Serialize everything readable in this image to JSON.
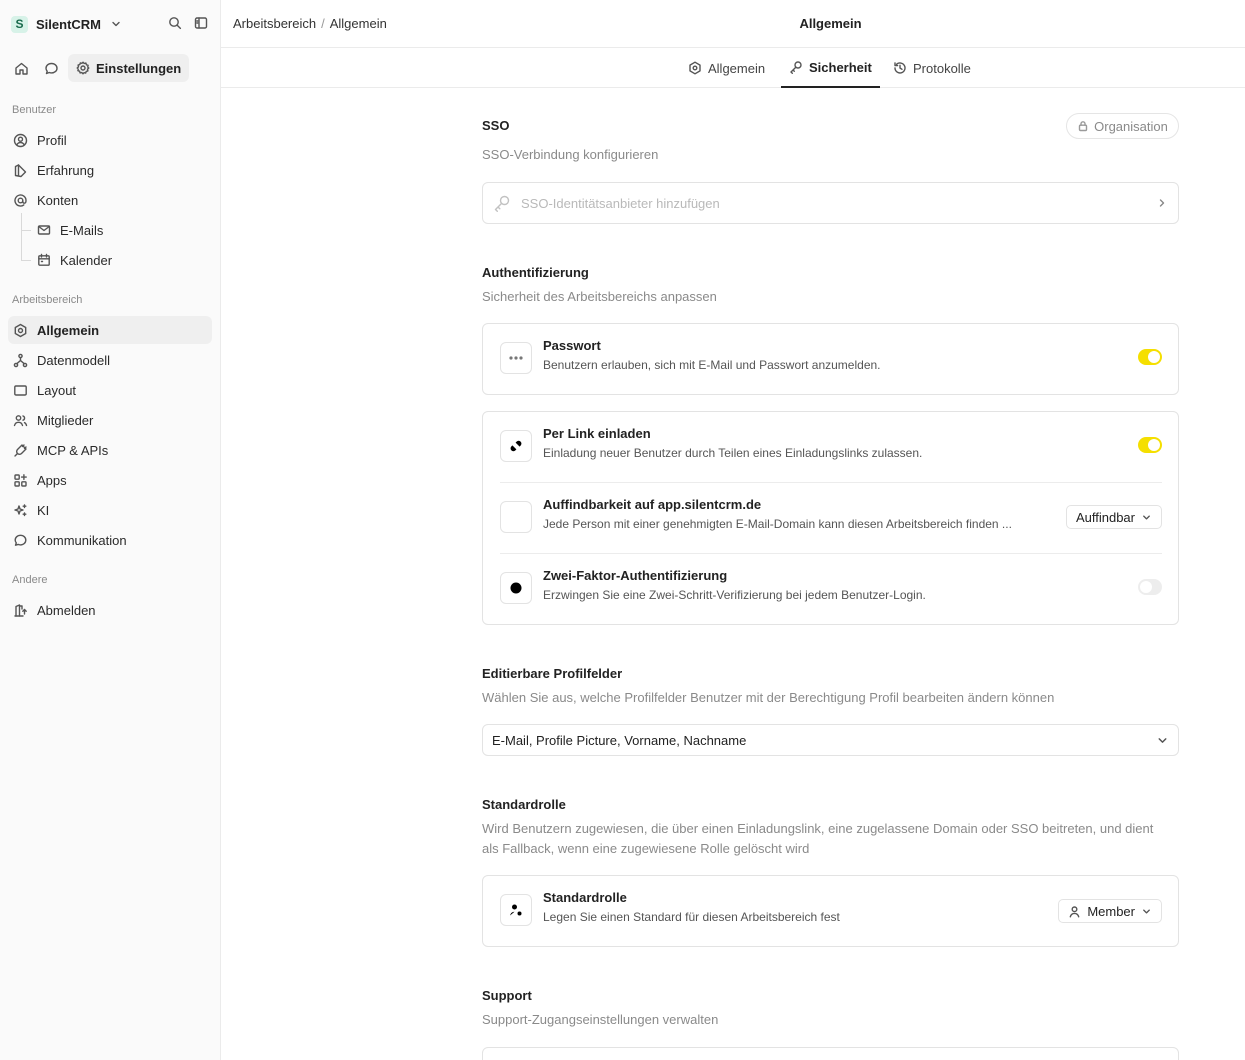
{
  "workspace": {
    "logo_letter": "S",
    "name": "SilentCRM"
  },
  "sidebar": {
    "top_nav": {
      "settings_label": "Einstellungen"
    },
    "sections": {
      "user": "Benutzer",
      "workspace": "Arbeitsbereich",
      "other": "Andere"
    },
    "user_items": [
      "Profil",
      "Erfahrung",
      "Konten",
      "E-Mails",
      "Kalender"
    ],
    "workspace_items": [
      "Allgemein",
      "Datenmodell",
      "Layout",
      "Mitglieder",
      "MCP & APIs",
      "Apps",
      "KI",
      "Kommunikation"
    ],
    "other_items": [
      "Abmelden"
    ]
  },
  "header": {
    "breadcrumb": [
      "Arbeitsbereich",
      "/",
      "Allgemein"
    ],
    "title": "Allgemein"
  },
  "tabs": [
    "Allgemein",
    "Sicherheit",
    "Protokolle"
  ],
  "active_tab": "Sicherheit",
  "sso": {
    "title": "SSO",
    "badge": "Organisation",
    "description": "SSO-Verbindung konfigurieren",
    "add_placeholder": "SSO-Identitätsanbieter hinzufügen"
  },
  "auth": {
    "title": "Authentifizierung",
    "description": "Sicherheit des Arbeitsbereichs anpassen",
    "password": {
      "title": "Passwort",
      "subtitle": "Benutzern erlauben, sich mit E-Mail und Passwort anzumelden.",
      "enabled": true
    },
    "invite_link": {
      "title": "Per Link einladen",
      "subtitle": "Einladung neuer Benutzer durch Teilen eines Einladungslinks zulassen.",
      "enabled": true
    },
    "discoverability": {
      "title": "Auffindbarkeit auf app.silentcrm.de",
      "subtitle": "Jede Person mit einer genehmigten E-Mail-Domain kann diesen Arbeitsbereich finden ...",
      "value": "Auffindbar"
    },
    "two_factor": {
      "title": "Zwei-Faktor-Authentifizierung",
      "subtitle": "Erzwingen Sie eine Zwei-Schritt-Verifizierung bei jedem Benutzer-Login.",
      "enabled": false
    }
  },
  "profile_fields": {
    "title": "Editierbare Profilfelder",
    "description": "Wählen Sie aus, welche Profilfelder Benutzer mit der Berechtigung Profil bearbeiten ändern können",
    "value": "E-Mail, Profile Picture, Vorname, Nachname"
  },
  "default_role": {
    "title": "Standardrolle",
    "description": "Wird Benutzern zugewiesen, die über einen Einladungslink, eine zugelassene Domain oder SSO beitreten, und dient als Fallback, wenn eine zugewiesene Rolle gelöscht wird",
    "row_title": "Standardrolle",
    "row_subtitle": "Legen Sie einen Standard für diesen Arbeitsbereich fest",
    "value": "Member"
  },
  "support": {
    "title": "Support",
    "description": "Support-Zugangseinstellungen verwalten"
  },
  "colors": {
    "toggle_on": "#f5df00",
    "toggle_off": "#ededed",
    "accent_logo": "#d7f2e8"
  }
}
